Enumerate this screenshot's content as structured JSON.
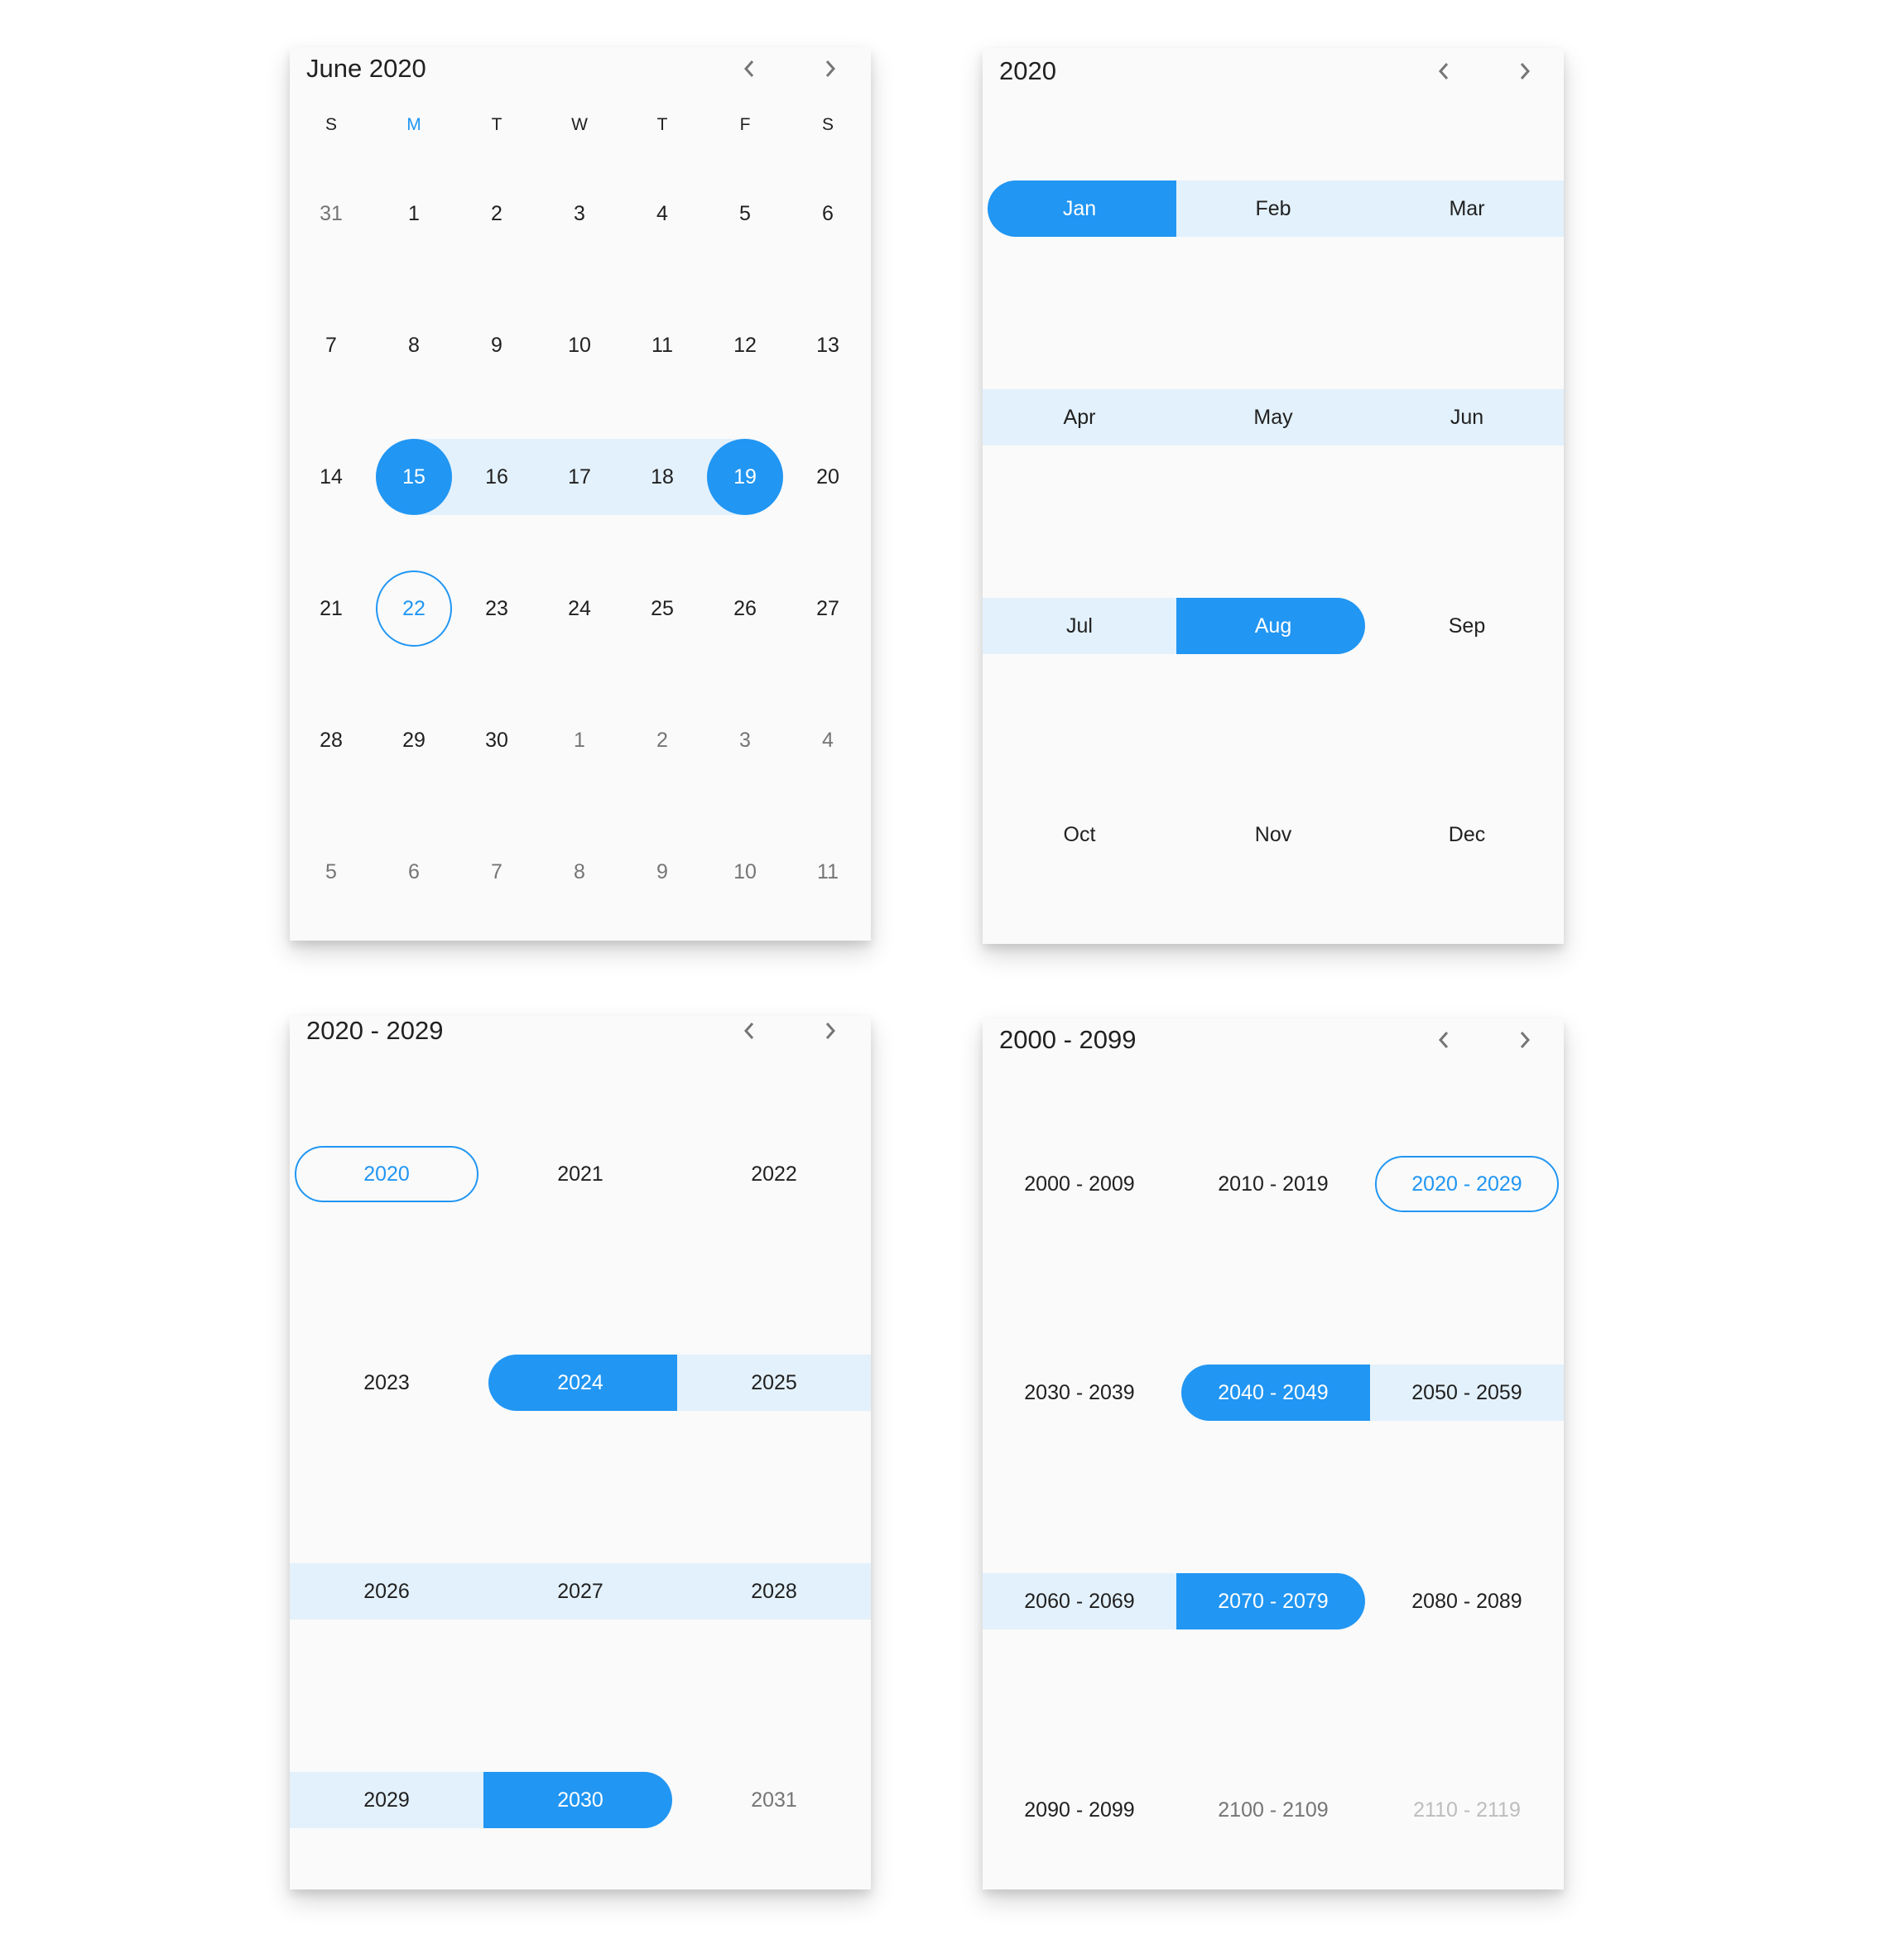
{
  "colors": {
    "accent": "#2196f3",
    "range": "#e3f1fc",
    "text": "#212121",
    "muted": "#757575",
    "faint": "#bdbdbd",
    "card": "#fafafa"
  },
  "month_view": {
    "title": "June 2020",
    "prev_icon": "chevron-left-icon",
    "next_icon": "chevron-right-icon",
    "weekdays": [
      "S",
      "M",
      "T",
      "W",
      "T",
      "F",
      "S"
    ],
    "today_weekday_index": 1,
    "weeks": [
      [
        {
          "d": "31",
          "other": true
        },
        {
          "d": "1"
        },
        {
          "d": "2"
        },
        {
          "d": "3"
        },
        {
          "d": "4"
        },
        {
          "d": "5"
        },
        {
          "d": "6"
        }
      ],
      [
        {
          "d": "7"
        },
        {
          "d": "8"
        },
        {
          "d": "9"
        },
        {
          "d": "10"
        },
        {
          "d": "11"
        },
        {
          "d": "12"
        },
        {
          "d": "13"
        }
      ],
      [
        {
          "d": "14"
        },
        {
          "d": "15",
          "state": "range-start"
        },
        {
          "d": "16",
          "state": "in-range"
        },
        {
          "d": "17",
          "state": "in-range"
        },
        {
          "d": "18",
          "state": "in-range"
        },
        {
          "d": "19",
          "state": "range-end"
        },
        {
          "d": "20"
        }
      ],
      [
        {
          "d": "21"
        },
        {
          "d": "22",
          "state": "today"
        },
        {
          "d": "23"
        },
        {
          "d": "24"
        },
        {
          "d": "25"
        },
        {
          "d": "26"
        },
        {
          "d": "27"
        }
      ],
      [
        {
          "d": "28"
        },
        {
          "d": "29"
        },
        {
          "d": "30"
        },
        {
          "d": "1",
          "other": true
        },
        {
          "d": "2",
          "other": true
        },
        {
          "d": "3",
          "other": true
        },
        {
          "d": "4",
          "other": true
        }
      ],
      [
        {
          "d": "5",
          "other": true
        },
        {
          "d": "6",
          "other": true
        },
        {
          "d": "7",
          "other": true
        },
        {
          "d": "8",
          "other": true
        },
        {
          "d": "9",
          "other": true
        },
        {
          "d": "10",
          "other": true
        },
        {
          "d": "11",
          "other": true
        }
      ]
    ]
  },
  "year_view": {
    "title": "2020",
    "cells": [
      {
        "label": "Jan",
        "state": "range-start"
      },
      {
        "label": "Feb",
        "state": "in-range"
      },
      {
        "label": "Mar",
        "state": "in-range"
      },
      {
        "label": "Apr",
        "state": "in-range"
      },
      {
        "label": "May",
        "state": "in-range"
      },
      {
        "label": "Jun",
        "state": "in-range"
      },
      {
        "label": "Jul",
        "state": "in-range"
      },
      {
        "label": "Aug",
        "state": "range-end"
      },
      {
        "label": "Sep"
      },
      {
        "label": "Oct"
      },
      {
        "label": "Nov"
      },
      {
        "label": "Dec"
      }
    ]
  },
  "decade_view": {
    "title": "2020 - 2029",
    "cells": [
      {
        "label": "2020",
        "state": "today"
      },
      {
        "label": "2021"
      },
      {
        "label": "2022"
      },
      {
        "label": "2023"
      },
      {
        "label": "2024",
        "state": "range-start"
      },
      {
        "label": "2025",
        "state": "in-range"
      },
      {
        "label": "2026",
        "state": "in-range"
      },
      {
        "label": "2027",
        "state": "in-range"
      },
      {
        "label": "2028",
        "state": "in-range"
      },
      {
        "label": "2029",
        "state": "in-range"
      },
      {
        "label": "2030",
        "state": "range-end"
      },
      {
        "label": "2031",
        "tone": "muted"
      }
    ]
  },
  "century_view": {
    "title": "2000 - 2099",
    "cells": [
      {
        "label": "2000 - 2009"
      },
      {
        "label": "2010 - 2019"
      },
      {
        "label": "2020 - 2029",
        "state": "today"
      },
      {
        "label": "2030 - 2039"
      },
      {
        "label": "2040 - 2049",
        "state": "range-start"
      },
      {
        "label": "2050 - 2059",
        "state": "in-range"
      },
      {
        "label": "2060 - 2069",
        "state": "in-range"
      },
      {
        "label": "2070 - 2079",
        "state": "range-end"
      },
      {
        "label": "2080 - 2089"
      },
      {
        "label": "2090 - 2099"
      },
      {
        "label": "2100 - 2109",
        "tone": "muted"
      },
      {
        "label": "2110 - 2119",
        "tone": "faint"
      }
    ]
  }
}
